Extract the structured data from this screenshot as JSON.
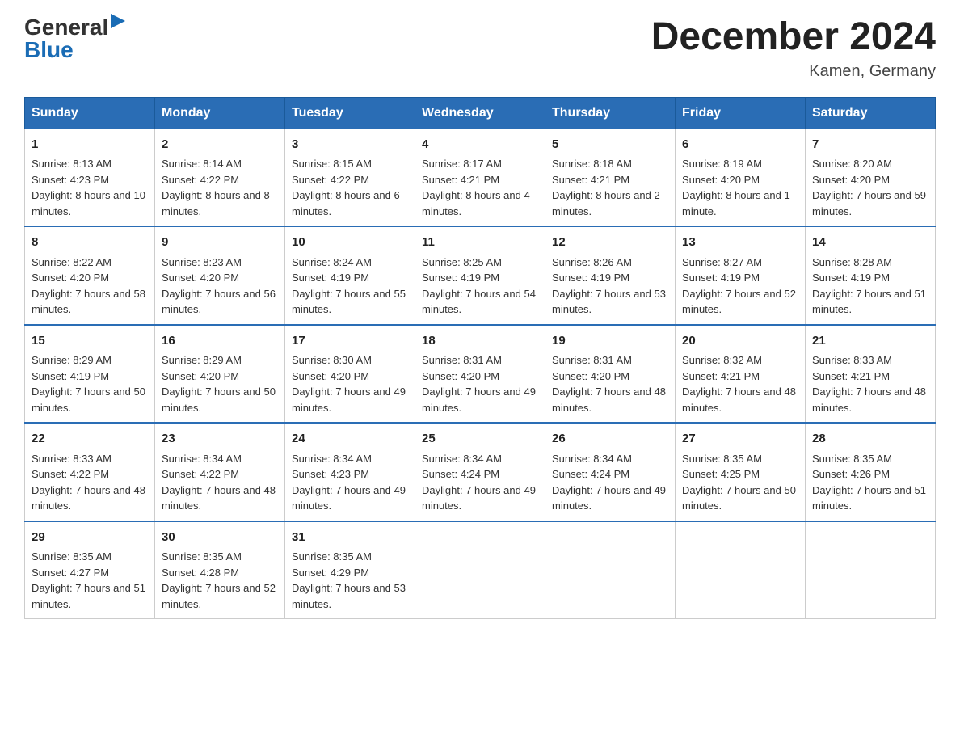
{
  "header": {
    "logo": {
      "general": "General",
      "arrow": "▶",
      "blue": "Blue"
    },
    "title": "December 2024",
    "location": "Kamen, Germany"
  },
  "weekdays": [
    "Sunday",
    "Monday",
    "Tuesday",
    "Wednesday",
    "Thursday",
    "Friday",
    "Saturday"
  ],
  "weeks": [
    [
      {
        "day": "1",
        "sunrise": "Sunrise: 8:13 AM",
        "sunset": "Sunset: 4:23 PM",
        "daylight": "Daylight: 8 hours and 10 minutes."
      },
      {
        "day": "2",
        "sunrise": "Sunrise: 8:14 AM",
        "sunset": "Sunset: 4:22 PM",
        "daylight": "Daylight: 8 hours and 8 minutes."
      },
      {
        "day": "3",
        "sunrise": "Sunrise: 8:15 AM",
        "sunset": "Sunset: 4:22 PM",
        "daylight": "Daylight: 8 hours and 6 minutes."
      },
      {
        "day": "4",
        "sunrise": "Sunrise: 8:17 AM",
        "sunset": "Sunset: 4:21 PM",
        "daylight": "Daylight: 8 hours and 4 minutes."
      },
      {
        "day": "5",
        "sunrise": "Sunrise: 8:18 AM",
        "sunset": "Sunset: 4:21 PM",
        "daylight": "Daylight: 8 hours and 2 minutes."
      },
      {
        "day": "6",
        "sunrise": "Sunrise: 8:19 AM",
        "sunset": "Sunset: 4:20 PM",
        "daylight": "Daylight: 8 hours and 1 minute."
      },
      {
        "day": "7",
        "sunrise": "Sunrise: 8:20 AM",
        "sunset": "Sunset: 4:20 PM",
        "daylight": "Daylight: 7 hours and 59 minutes."
      }
    ],
    [
      {
        "day": "8",
        "sunrise": "Sunrise: 8:22 AM",
        "sunset": "Sunset: 4:20 PM",
        "daylight": "Daylight: 7 hours and 58 minutes."
      },
      {
        "day": "9",
        "sunrise": "Sunrise: 8:23 AM",
        "sunset": "Sunset: 4:20 PM",
        "daylight": "Daylight: 7 hours and 56 minutes."
      },
      {
        "day": "10",
        "sunrise": "Sunrise: 8:24 AM",
        "sunset": "Sunset: 4:19 PM",
        "daylight": "Daylight: 7 hours and 55 minutes."
      },
      {
        "day": "11",
        "sunrise": "Sunrise: 8:25 AM",
        "sunset": "Sunset: 4:19 PM",
        "daylight": "Daylight: 7 hours and 54 minutes."
      },
      {
        "day": "12",
        "sunrise": "Sunrise: 8:26 AM",
        "sunset": "Sunset: 4:19 PM",
        "daylight": "Daylight: 7 hours and 53 minutes."
      },
      {
        "day": "13",
        "sunrise": "Sunrise: 8:27 AM",
        "sunset": "Sunset: 4:19 PM",
        "daylight": "Daylight: 7 hours and 52 minutes."
      },
      {
        "day": "14",
        "sunrise": "Sunrise: 8:28 AM",
        "sunset": "Sunset: 4:19 PM",
        "daylight": "Daylight: 7 hours and 51 minutes."
      }
    ],
    [
      {
        "day": "15",
        "sunrise": "Sunrise: 8:29 AM",
        "sunset": "Sunset: 4:19 PM",
        "daylight": "Daylight: 7 hours and 50 minutes."
      },
      {
        "day": "16",
        "sunrise": "Sunrise: 8:29 AM",
        "sunset": "Sunset: 4:20 PM",
        "daylight": "Daylight: 7 hours and 50 minutes."
      },
      {
        "day": "17",
        "sunrise": "Sunrise: 8:30 AM",
        "sunset": "Sunset: 4:20 PM",
        "daylight": "Daylight: 7 hours and 49 minutes."
      },
      {
        "day": "18",
        "sunrise": "Sunrise: 8:31 AM",
        "sunset": "Sunset: 4:20 PM",
        "daylight": "Daylight: 7 hours and 49 minutes."
      },
      {
        "day": "19",
        "sunrise": "Sunrise: 8:31 AM",
        "sunset": "Sunset: 4:20 PM",
        "daylight": "Daylight: 7 hours and 48 minutes."
      },
      {
        "day": "20",
        "sunrise": "Sunrise: 8:32 AM",
        "sunset": "Sunset: 4:21 PM",
        "daylight": "Daylight: 7 hours and 48 minutes."
      },
      {
        "day": "21",
        "sunrise": "Sunrise: 8:33 AM",
        "sunset": "Sunset: 4:21 PM",
        "daylight": "Daylight: 7 hours and 48 minutes."
      }
    ],
    [
      {
        "day": "22",
        "sunrise": "Sunrise: 8:33 AM",
        "sunset": "Sunset: 4:22 PM",
        "daylight": "Daylight: 7 hours and 48 minutes."
      },
      {
        "day": "23",
        "sunrise": "Sunrise: 8:34 AM",
        "sunset": "Sunset: 4:22 PM",
        "daylight": "Daylight: 7 hours and 48 minutes."
      },
      {
        "day": "24",
        "sunrise": "Sunrise: 8:34 AM",
        "sunset": "Sunset: 4:23 PM",
        "daylight": "Daylight: 7 hours and 49 minutes."
      },
      {
        "day": "25",
        "sunrise": "Sunrise: 8:34 AM",
        "sunset": "Sunset: 4:24 PM",
        "daylight": "Daylight: 7 hours and 49 minutes."
      },
      {
        "day": "26",
        "sunrise": "Sunrise: 8:34 AM",
        "sunset": "Sunset: 4:24 PM",
        "daylight": "Daylight: 7 hours and 49 minutes."
      },
      {
        "day": "27",
        "sunrise": "Sunrise: 8:35 AM",
        "sunset": "Sunset: 4:25 PM",
        "daylight": "Daylight: 7 hours and 50 minutes."
      },
      {
        "day": "28",
        "sunrise": "Sunrise: 8:35 AM",
        "sunset": "Sunset: 4:26 PM",
        "daylight": "Daylight: 7 hours and 51 minutes."
      }
    ],
    [
      {
        "day": "29",
        "sunrise": "Sunrise: 8:35 AM",
        "sunset": "Sunset: 4:27 PM",
        "daylight": "Daylight: 7 hours and 51 minutes."
      },
      {
        "day": "30",
        "sunrise": "Sunrise: 8:35 AM",
        "sunset": "Sunset: 4:28 PM",
        "daylight": "Daylight: 7 hours and 52 minutes."
      },
      {
        "day": "31",
        "sunrise": "Sunrise: 8:35 AM",
        "sunset": "Sunset: 4:29 PM",
        "daylight": "Daylight: 7 hours and 53 minutes."
      },
      null,
      null,
      null,
      null
    ]
  ]
}
